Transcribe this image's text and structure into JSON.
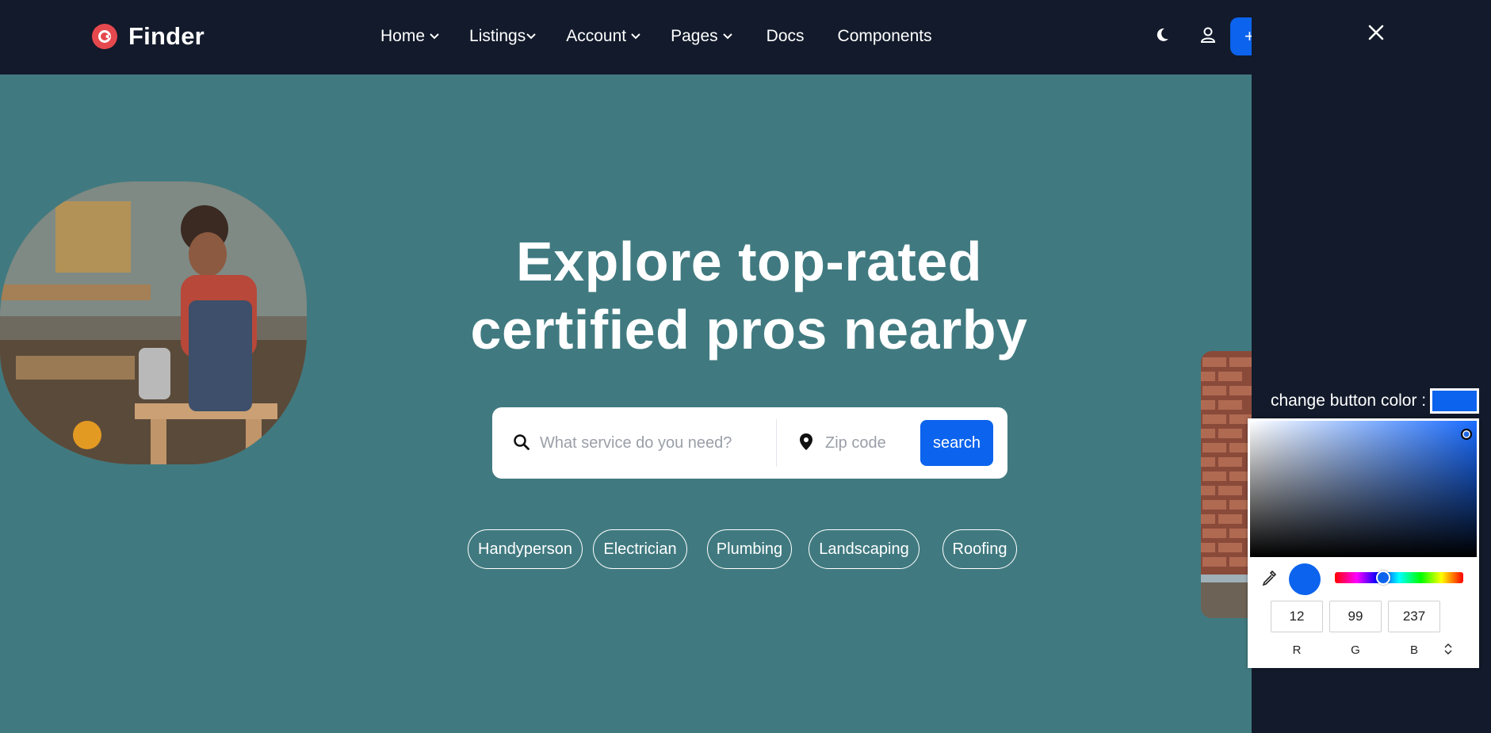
{
  "navbar": {
    "brand": "Finder",
    "links": [
      {
        "label": "Home",
        "dropdown": true
      },
      {
        "label": "Listings",
        "dropdown": true
      },
      {
        "label": "Account",
        "dropdown": true
      },
      {
        "label": "Pages",
        "dropdown": true
      },
      {
        "label": "Docs",
        "dropdown": false
      },
      {
        "label": "Components",
        "dropdown": false
      }
    ],
    "add_button_label": "+"
  },
  "hero": {
    "title_line1": "Explore top-rated",
    "title_line2": "certified pros nearby"
  },
  "search": {
    "service_placeholder": "What service do you need?",
    "zip_placeholder": "Zip code",
    "button_label": "search"
  },
  "tags": [
    "Handyperson",
    "Electrician",
    "Plumbing",
    "Landscaping",
    "Roofing"
  ],
  "side_panel": {
    "close_label": "X",
    "color_label": "change button color :",
    "picker": {
      "r": "12",
      "g": "99",
      "b": "237",
      "r_label": "R",
      "g_label": "G",
      "b_label": "B"
    }
  },
  "colors": {
    "navbar_bg": "#121a2b",
    "page_bg": "#407a80",
    "accent": "#0c63ed",
    "brand_logo": "#e5484d"
  }
}
